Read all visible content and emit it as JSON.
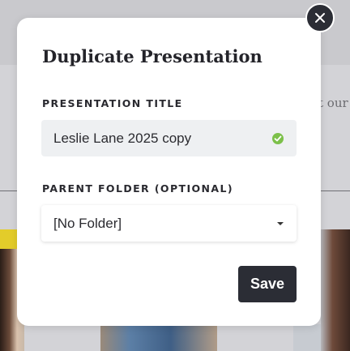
{
  "modal": {
    "title": "Duplicate Presentation",
    "presentation_title_label": "PRESENTATION TITLE",
    "presentation_title_value": "Leslie Lane 2025 copy",
    "parent_folder_label": "PARENT FOLDER (OPTIONAL)",
    "parent_folder_value": "[No Folder]",
    "save_label": "Save"
  },
  "background": {
    "partial_text": "t our"
  },
  "icons": {
    "close": "close-icon",
    "valid": "checkmark-icon",
    "dropdown": "chevron-down-icon"
  },
  "colors": {
    "primary_button": "#2b2d35",
    "success": "#7cc04a",
    "input_bg": "#eef0f2"
  }
}
